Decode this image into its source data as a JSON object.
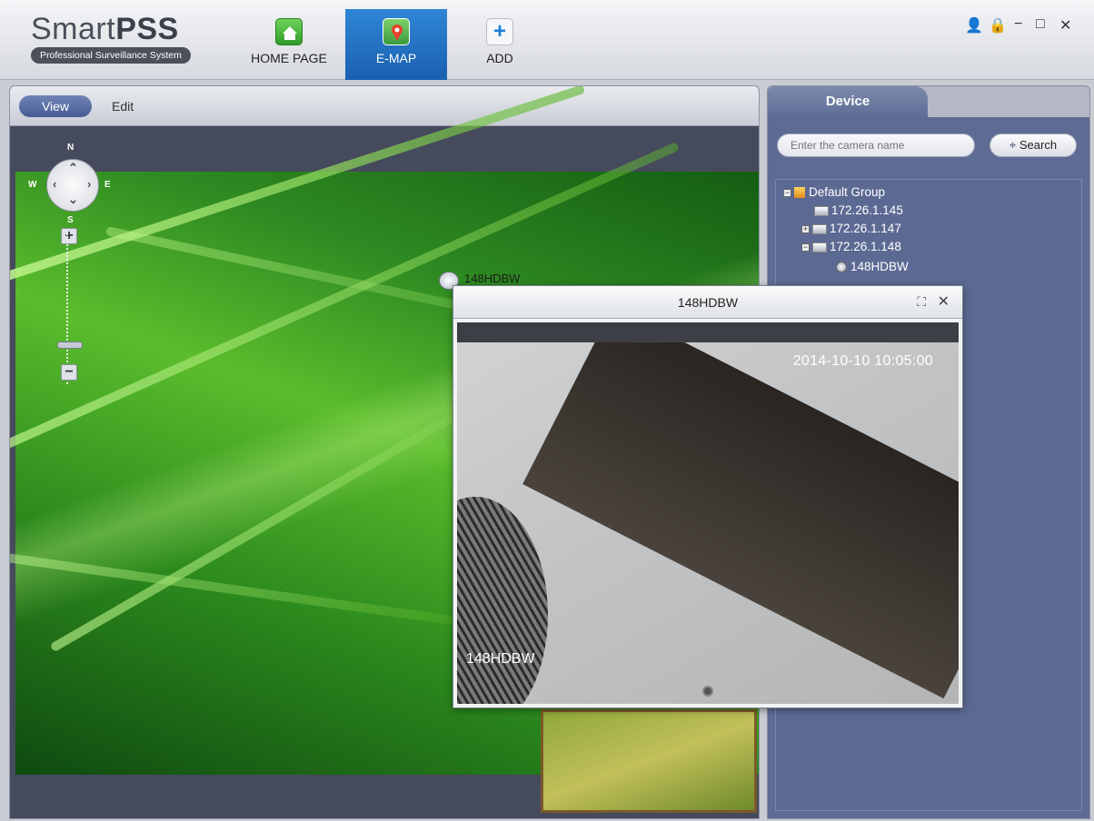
{
  "app": {
    "logo_title_plain": "Smart",
    "logo_title_bold": "PSS",
    "logo_subtitle": "Professional Surveillance System"
  },
  "nav": {
    "home_label": "HOME PAGE",
    "emap_label": "E-MAP",
    "add_label": "ADD"
  },
  "window_controls": {
    "user": "👤",
    "lock": "🔒",
    "minimize": "−",
    "maximize": "□",
    "close": "✕"
  },
  "map": {
    "tab_view": "View",
    "tab_edit": "Edit",
    "compass_n": "N",
    "compass_s": "S",
    "compass_w": "W",
    "compass_e": "E",
    "zoom_in": "+",
    "zoom_out": "−",
    "camera_label": "148HDBW"
  },
  "popup": {
    "title": "148HDBW",
    "osd_time": "2014-10-10 10:05:00",
    "osd_name": "148HDBW"
  },
  "device_panel": {
    "tab_label": "Device",
    "search_placeholder": "Enter the camera name",
    "search_button": "Search",
    "tree": {
      "group": "Default Group",
      "dev1": "172.26.1.145",
      "dev2": "172.26.1.147",
      "dev3": "172.26.1.148",
      "cam1": "148HDBW"
    }
  }
}
